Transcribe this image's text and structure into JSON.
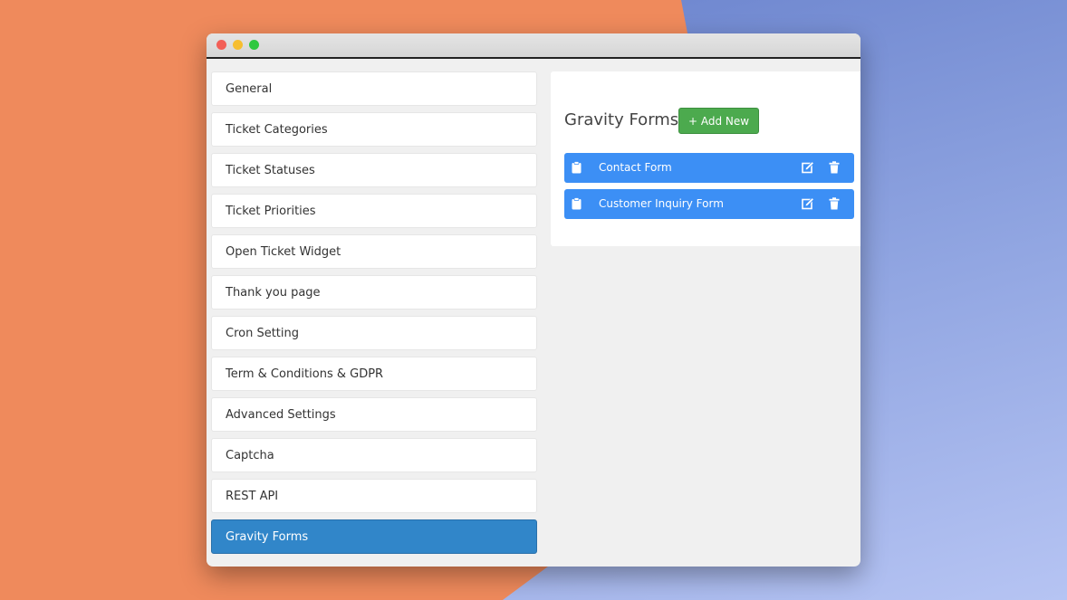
{
  "sidebar": {
    "items": [
      {
        "label": "General"
      },
      {
        "label": "Ticket Categories"
      },
      {
        "label": "Ticket Statuses"
      },
      {
        "label": "Ticket Priorities"
      },
      {
        "label": "Open Ticket Widget"
      },
      {
        "label": "Thank you page"
      },
      {
        "label": "Cron Setting"
      },
      {
        "label": "Term & Conditions & GDPR"
      },
      {
        "label": "Advanced Settings"
      },
      {
        "label": "Captcha"
      },
      {
        "label": "REST API"
      },
      {
        "label": "Gravity Forms",
        "active": true
      }
    ]
  },
  "panel": {
    "title": "Gravity Forms",
    "add_button": "+ Add New",
    "forms": [
      {
        "label": "Contact Form",
        "icon": "clipboard-icon"
      },
      {
        "label": "Customer Inquiry Form",
        "icon": "clipboard-icon"
      }
    ]
  },
  "colors": {
    "active_item": "#3186c9",
    "form_row": "#3c8ff5",
    "add_button": "#4caa4e"
  }
}
